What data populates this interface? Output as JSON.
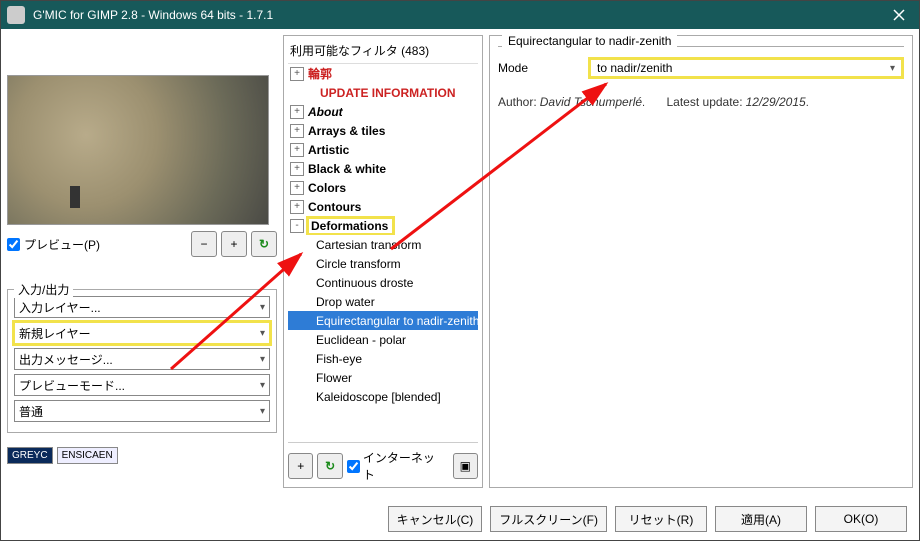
{
  "window": {
    "title": "G'MIC for GIMP 2.8 - Windows 64 bits - 1.7.1"
  },
  "preview": {
    "checkbox_label": "プレビュー(P)"
  },
  "io": {
    "legend": "入力/出力",
    "input_layer": "入力レイヤー...",
    "output_layer": "新規レイヤー",
    "output_msg": "出力メッセージ...",
    "preview_mode": "プレビューモード...",
    "normal": "普通"
  },
  "logos": {
    "a": "GREYC",
    "b": "ENSICAEN"
  },
  "tree": {
    "header": "利用可能なフィルタ (483)",
    "items": [
      {
        "t": "cat",
        "exp": "+",
        "label": "輪郭",
        "red": true
      },
      {
        "t": "upd",
        "label": "UPDATE INFORMATION"
      },
      {
        "t": "cat",
        "exp": "+",
        "label": "About",
        "italic": true
      },
      {
        "t": "cat",
        "exp": "+",
        "label": "Arrays & tiles"
      },
      {
        "t": "cat",
        "exp": "+",
        "label": "Artistic"
      },
      {
        "t": "cat",
        "exp": "+",
        "label": "Black & white"
      },
      {
        "t": "cat",
        "exp": "+",
        "label": "Colors"
      },
      {
        "t": "cat",
        "exp": "+",
        "label": "Contours"
      },
      {
        "t": "cat",
        "exp": "-",
        "label": "Deformations",
        "hl": true
      },
      {
        "t": "child",
        "label": "Cartesian transform"
      },
      {
        "t": "child",
        "label": "Circle transform"
      },
      {
        "t": "child",
        "label": "Continuous droste"
      },
      {
        "t": "child",
        "label": "Drop water"
      },
      {
        "t": "child",
        "label": "Equirectangular to nadir-zenith",
        "sel": true
      },
      {
        "t": "child",
        "label": "Euclidean - polar"
      },
      {
        "t": "child",
        "label": "Fish-eye"
      },
      {
        "t": "child",
        "label": "Flower"
      },
      {
        "t": "child",
        "label": "Kaleidoscope [blended]"
      }
    ],
    "internet_label": "インターネット"
  },
  "right": {
    "title": "Equirectangular to nadir-zenith",
    "mode_label": "Mode",
    "mode_value": "to nadir/zenith",
    "author_lbl": "Author:",
    "author": "David Tschumperlé",
    "latest_lbl": "Latest update:",
    "latest": "12/29/2015"
  },
  "buttons": {
    "cancel": "キャンセル(C)",
    "fullscreen": "フルスクリーン(F)",
    "reset": "リセット(R)",
    "apply": "適用(A)",
    "ok": "OK(O)"
  }
}
